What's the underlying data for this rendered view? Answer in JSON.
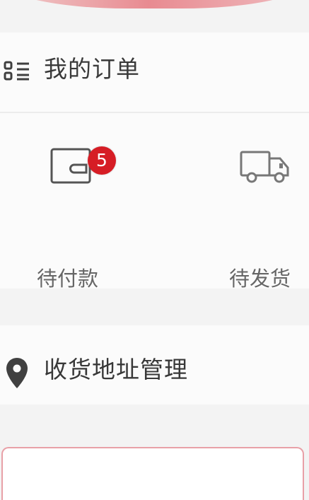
{
  "orders": {
    "title": "我的订单",
    "icon": "list-icon",
    "items": [
      {
        "label": "待付款",
        "icon": "wallet-icon",
        "badge_count": "5"
      },
      {
        "label": "待发货",
        "icon": "truck-icon"
      }
    ]
  },
  "address": {
    "title": "收货地址管理",
    "icon": "location-pin-icon"
  },
  "colors": {
    "badge": "#d61d25",
    "text_primary": "#3a3a3a",
    "text_secondary": "#666666",
    "accent_border": "#e8a0a7",
    "background": "#f3f3f3",
    "card": "#fbfbfb"
  }
}
